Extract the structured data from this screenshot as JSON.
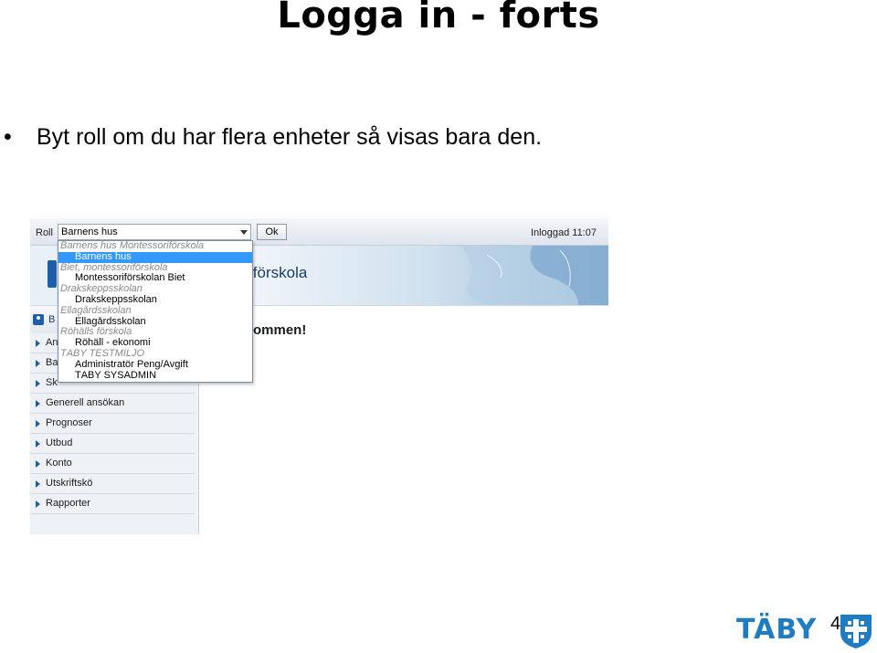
{
  "slide": {
    "title": "Logga in - forts",
    "bullet_symbol": "•",
    "bullet_text": "Byt roll om du har flera enheter så visas bara den.",
    "page_number": "4",
    "logo_text": "TÄBY"
  },
  "app": {
    "toolbar": {
      "roll_label": "Roll",
      "role_select_value": "Barnens hus",
      "ok_label": "Ok",
      "inloggad_text": "Inloggad 11:07"
    },
    "banner_title": "iförskola",
    "welcome_text": "ommen!",
    "sidebar": {
      "header_text": "B",
      "items": [
        {
          "label": "An"
        },
        {
          "label": "Ba"
        },
        {
          "label": "Sk"
        },
        {
          "label": "Generell ansökan"
        },
        {
          "label": "Prognoser"
        },
        {
          "label": "Utbud"
        },
        {
          "label": "Konto"
        },
        {
          "label": "Utskriftskö"
        },
        {
          "label": "Rapporter"
        }
      ]
    },
    "role_dropdown": {
      "rows": [
        {
          "type": "group",
          "label": "Barnens hus Montessoriförskola"
        },
        {
          "type": "option",
          "label": "Barnens hus",
          "selected": true
        },
        {
          "type": "group",
          "label": "Biet, montessoriförskola"
        },
        {
          "type": "option",
          "label": "Montessoriförskolan Biet"
        },
        {
          "type": "group",
          "label": "Drakskeppsskolan"
        },
        {
          "type": "option",
          "label": "Drakskeppsskolan"
        },
        {
          "type": "group",
          "label": "Ellagårdsskolan"
        },
        {
          "type": "option",
          "label": "Ellagårdsskolan"
        },
        {
          "type": "group",
          "label": "Röhälls förskola"
        },
        {
          "type": "option",
          "label": "Röhäll - ekonomi"
        },
        {
          "type": "group",
          "label": "TÄBY TESTMILJÖ"
        },
        {
          "type": "option",
          "label": "Administratör Peng/Avgift"
        },
        {
          "type": "option",
          "label": "TÄBY SYSADMIN"
        }
      ]
    }
  },
  "colors": {
    "accent": "#1e5ea8",
    "selected_option": "#3399ff",
    "taby_brand": "#1e7cc3"
  }
}
